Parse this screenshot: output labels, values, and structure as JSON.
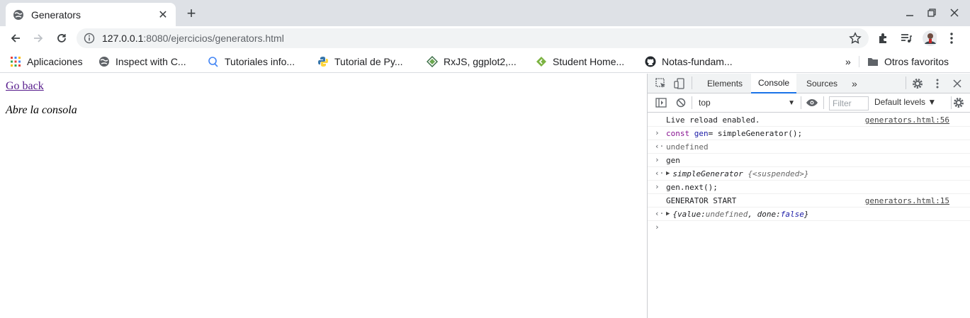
{
  "tab": {
    "title": "Generators",
    "close": "✕",
    "new_tab": "+"
  },
  "window": {
    "minimize": "—",
    "restore": "❐",
    "close": "✕"
  },
  "address": {
    "host": "127.0.0.1",
    "rest": ":8080/ejercicios/generators.html"
  },
  "bookmarks": [
    {
      "label": "Aplicaciones"
    },
    {
      "label": "Inspect with C..."
    },
    {
      "label": "Tutoriales info..."
    },
    {
      "label": "Tutorial de Py..."
    },
    {
      "label": "RxJS, ggplot2,..."
    },
    {
      "label": "Student Home..."
    },
    {
      "label": "Notas-fundam..."
    }
  ],
  "bookmarks_more": "»",
  "other_bookmarks": "Otros favoritos",
  "page": {
    "link": "Go back",
    "text": "Abre la consola"
  },
  "devtools": {
    "tabs": [
      "Elements",
      "Console",
      "Sources"
    ],
    "more": "»",
    "context": "top",
    "filter_placeholder": "Filter",
    "levels": "Default levels ▼",
    "console": {
      "l1_text": "Live reload enabled.",
      "l1_src": "generators.html:56",
      "l2_kw": "const",
      "l2_var": "gen",
      "l2_rest": " = simpleGenerator();",
      "l2_eq": " =",
      "l3_text": "undefined",
      "l4_text": "gen",
      "l5_name": "simpleGenerator",
      "l5_state": "{<suspended>}",
      "l6_text": "gen.next();",
      "l7_text": "GENERATOR START",
      "l7_src": "generators.html:15",
      "l8_open": "{value: ",
      "l8_value": "undefined",
      "l8_mid": ", done: ",
      "l8_done": "false",
      "l8_close": "}"
    }
  },
  "colors": {
    "accent": "#1a73e8",
    "visited_link": "#551a8b",
    "tabbar": "#dee1e6",
    "omnibox": "#f1f3f4"
  }
}
